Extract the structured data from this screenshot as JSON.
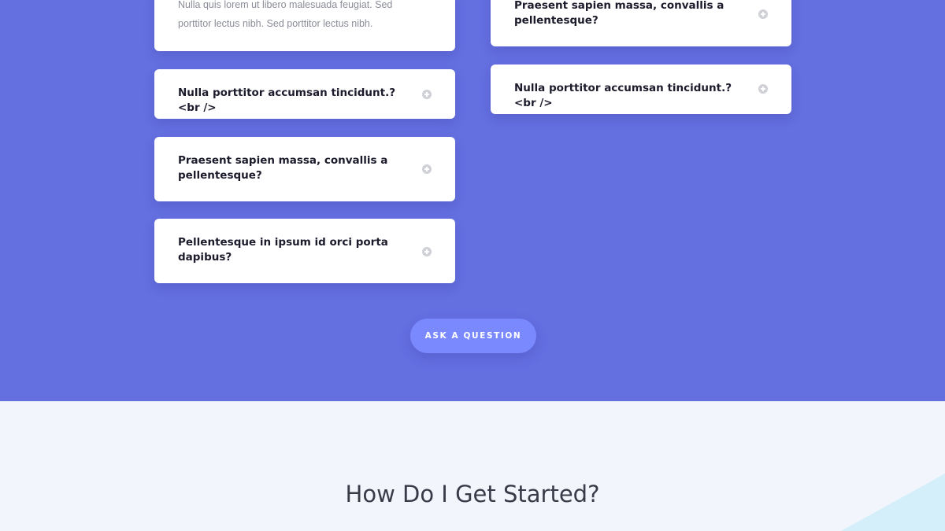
{
  "faq": {
    "left_column": [
      {
        "question": "",
        "answer": "Nulla quis lorem ut libero malesuada feugiat. Sed porttitor lectus nibh. Sed porttitor lectus nibh."
      },
      {
        "question": "Nulla porttitor accumsan tincidunt.?<br />"
      },
      {
        "question": "Praesent sapien massa, convallis a pellentesque?"
      },
      {
        "question": "Pellentesque in ipsum id orci porta dapibus?"
      }
    ],
    "right_column": [
      {
        "question": "Praesent sapien massa, convallis a pellentesque?"
      },
      {
        "question": "Nulla porttitor accumsan tincidunt.?<br />"
      }
    ],
    "ask_button_label": "ASK A QUESTION",
    "icons": {
      "toggle": "plus-circle-icon"
    },
    "colors": {
      "section_background": "#646fe0",
      "card_background": "#ffffff",
      "button_background": "#7b89ff"
    }
  },
  "started": {
    "title": "How Do I Get Started?",
    "colors": {
      "background": "#f2f6fc",
      "accent_shape": "#d4effa"
    }
  }
}
